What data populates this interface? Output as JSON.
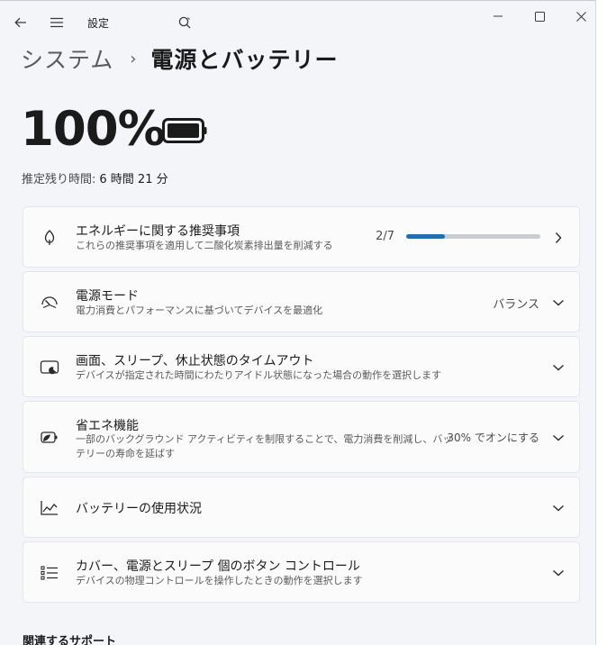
{
  "window": {
    "title": "設定"
  },
  "breadcrumb": {
    "parent": "システム",
    "separator": "›",
    "current": "電源とバッテリー"
  },
  "battery": {
    "percent_label": "100%",
    "remaining_label": "推定残り時間:",
    "remaining_value": "6 時間 21 分"
  },
  "cards": [
    {
      "title": "エネルギーに関する推奨事項",
      "desc": "これらの推奨事項を適用して二酸化炭素排出量を削減する",
      "value": "2/7",
      "progress": 0.29,
      "icon": "leaf-icon",
      "action": "chevron-right"
    },
    {
      "title": "電源モード",
      "desc": "電力消費とパフォーマンスに基づいてデバイスを最適化",
      "value": "バランス",
      "icon": "gauge-icon",
      "action": "chevron-down"
    },
    {
      "title": "画面、スリープ、休止状態のタイムアウト",
      "desc": "デバイスが指定された時間にわたりアイドル状態になった場合の動作を選択します",
      "icon": "screen-sleep-icon",
      "action": "chevron-down"
    },
    {
      "title": "省エネ機能",
      "desc": "一部のバックグラウンド アクティビティを制限することで、電力消費を削減し、バッテリーの寿命を延ばす",
      "value": "30% でオンにする",
      "icon": "battery-saver-icon",
      "action": "chevron-down"
    },
    {
      "title": "バッテリーの使用状況",
      "icon": "usage-chart-icon",
      "action": "chevron-down"
    },
    {
      "title": "カバー、電源とスリープ 個のボタン コントロール",
      "desc": "デバイスの物理コントロールを操作したときの動作を選択します",
      "icon": "list-icon",
      "action": "chevron-down"
    }
  ],
  "related": {
    "heading": "関連するサポート"
  },
  "colors": {
    "accent": "#1f6fb2",
    "background": "#f3f5f9",
    "card": "#fbfbfc"
  }
}
